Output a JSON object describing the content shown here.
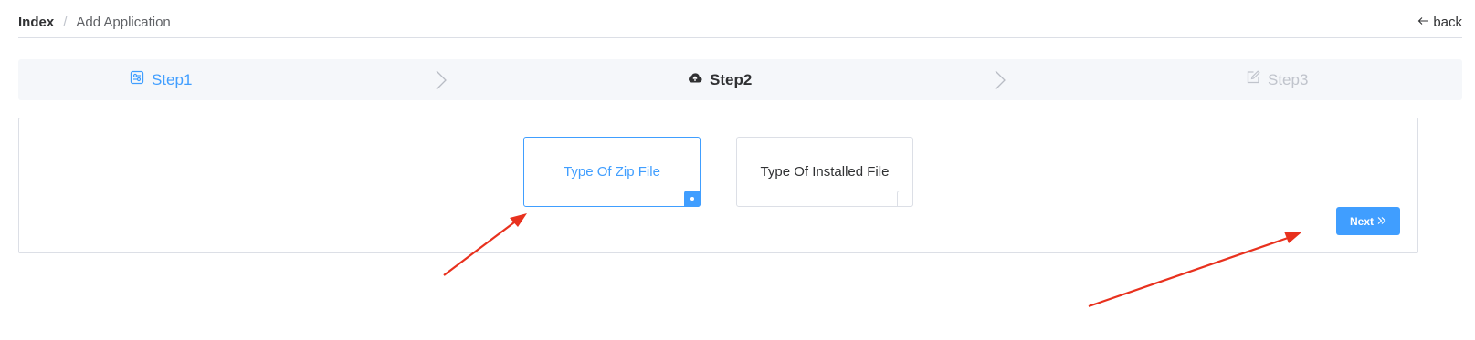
{
  "breadcrumb": {
    "root": "Index",
    "separator": "/",
    "current": "Add Application"
  },
  "back": {
    "label": "back",
    "icon": "arrow-left-icon"
  },
  "steps": [
    {
      "label": "Step1",
      "icon": "sliders-icon",
      "state": "finished"
    },
    {
      "label": "Step2",
      "icon": "cloud-upload-icon",
      "state": "active"
    },
    {
      "label": "Step3",
      "icon": "edit-icon",
      "state": "pending"
    }
  ],
  "options": [
    {
      "label": "Type Of Zip File",
      "selected": true
    },
    {
      "label": "Type Of Installed File",
      "selected": false
    }
  ],
  "next_button": {
    "label": "Next",
    "icon": "double-chevron-right-icon"
  },
  "colors": {
    "accent": "#409eff",
    "annotation_arrow": "#e8311e",
    "muted": "#c0c4cc"
  }
}
